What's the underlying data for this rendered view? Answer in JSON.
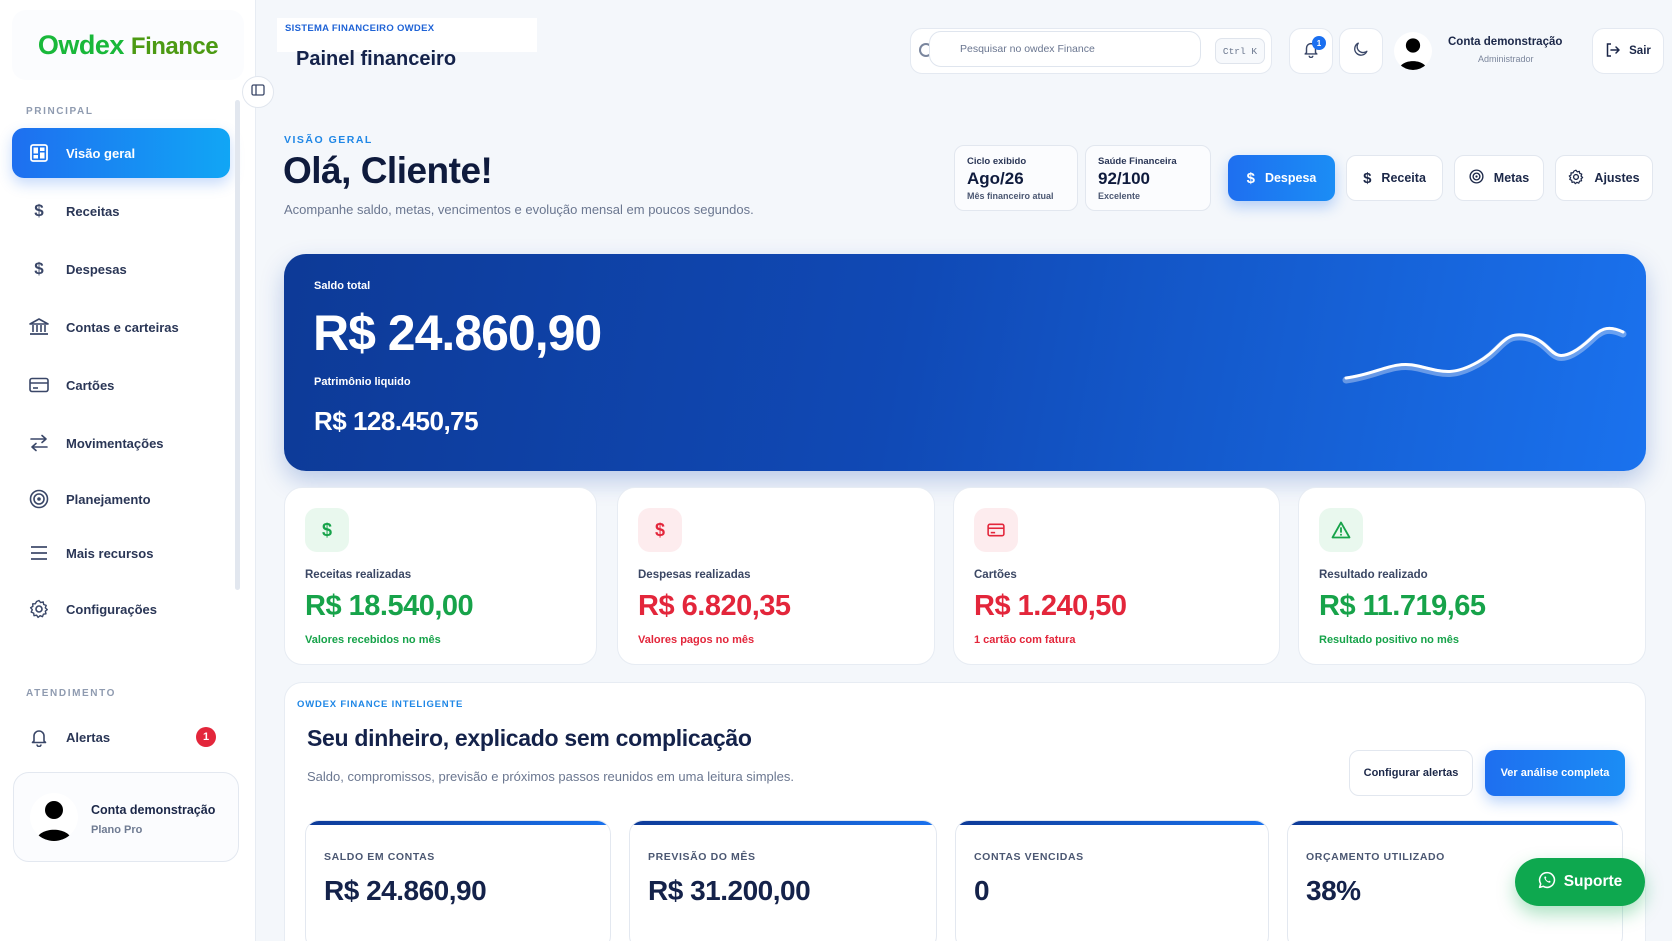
{
  "app": {
    "logo_part1": "Owdex",
    "logo_part2": "Finance"
  },
  "sidebar": {
    "section_main": "PRINCIPAL",
    "section_support": "ATENDIMENTO",
    "items": [
      {
        "label": "Visão geral",
        "icon": "dashboard-icon",
        "active": true
      },
      {
        "label": "Receitas",
        "icon": "dollar-icon"
      },
      {
        "label": "Despesas",
        "icon": "dollar-icon"
      },
      {
        "label": "Contas e carteiras",
        "icon": "bank-icon"
      },
      {
        "label": "Cartões",
        "icon": "card-icon"
      },
      {
        "label": "Movimentações",
        "icon": "transfer-icon"
      },
      {
        "label": "Planejamento",
        "icon": "target-icon"
      },
      {
        "label": "Mais recursos",
        "icon": "menu-icon"
      },
      {
        "label": "Configurações",
        "icon": "gear-icon"
      }
    ],
    "alerts": {
      "label": "Alertas",
      "count": "1"
    },
    "user": {
      "name": "Conta demonstração",
      "plan": "Plano Pro"
    }
  },
  "header": {
    "tag": "SISTEMA FINANCEIRO OWDEX",
    "title": "Painel financeiro",
    "search_placeholder": "Pesquisar no owdex Finance",
    "shortcut": "Ctrl K",
    "notification_count": "1",
    "user_name": "Conta demonstração",
    "user_role": "Administrador",
    "logout_label": "Sair"
  },
  "overview": {
    "eyebrow": "VISÃO GERAL",
    "greeting": "Olá, Cliente!",
    "subtitle": "Acompanhe saldo, metas, vencimentos e evolução mensal em poucos segundos.",
    "cycle": {
      "label": "Ciclo exibido",
      "value": "Ago/26",
      "sub": "Mês financeiro atual"
    },
    "health": {
      "label": "Saúde Financeira",
      "value": "92/100",
      "sub": "Excelente"
    },
    "actions": {
      "expense": "Despesa",
      "income": "Receita",
      "goals": "Metas",
      "settings": "Ajustes"
    }
  },
  "hero": {
    "balance_label": "Saldo total",
    "balance_value": "R$ 24.860,90",
    "networth_label": "Patrimônio liquido",
    "networth_value": "R$ 128.450,75"
  },
  "kpis": [
    {
      "label": "Receitas realizadas",
      "value": "R$ 18.540,00",
      "sub": "Valores recebidos no mês",
      "tone": "green",
      "icon": "dollar-icon"
    },
    {
      "label": "Despesas realizadas",
      "value": "R$ 6.820,35",
      "sub": "Valores pagos no mês",
      "tone": "red",
      "icon": "dollar-icon"
    },
    {
      "label": "Cartões",
      "value": "R$ 1.240,50",
      "sub": "1 cartão com fatura",
      "tone": "red",
      "icon": "card-icon"
    },
    {
      "label": "Resultado realizado",
      "value": "R$ 11.719,65",
      "sub": "Resultado positivo no mês",
      "tone": "green",
      "icon": "warning-icon"
    }
  ],
  "smart": {
    "eyebrow": "OWDEX FINANCE INTELIGENTE",
    "title": "Seu dinheiro, explicado sem complicação",
    "subtitle": "Saldo, compromissos, previsão e próximos passos reunidos em uma leitura simples.",
    "btn_alerts": "Configurar alertas",
    "btn_analysis": "Ver análise completa",
    "cards": [
      {
        "label": "SALDO EM CONTAS",
        "value": "R$ 24.860,90"
      },
      {
        "label": "PREVISÃO DO MÊS",
        "value": "R$ 31.200,00"
      },
      {
        "label": "CONTAS VENCIDAS",
        "value": "0"
      },
      {
        "label": "ORÇAMENTO UTILIZADO",
        "value": "38%"
      }
    ]
  },
  "support_label": "Suporte",
  "colors": {
    "primary": "#1e6ff0",
    "hero_dark": "#0d3a97",
    "positive": "#17a34a",
    "negative": "#e3263b",
    "whatsapp": "#0ea84f"
  }
}
